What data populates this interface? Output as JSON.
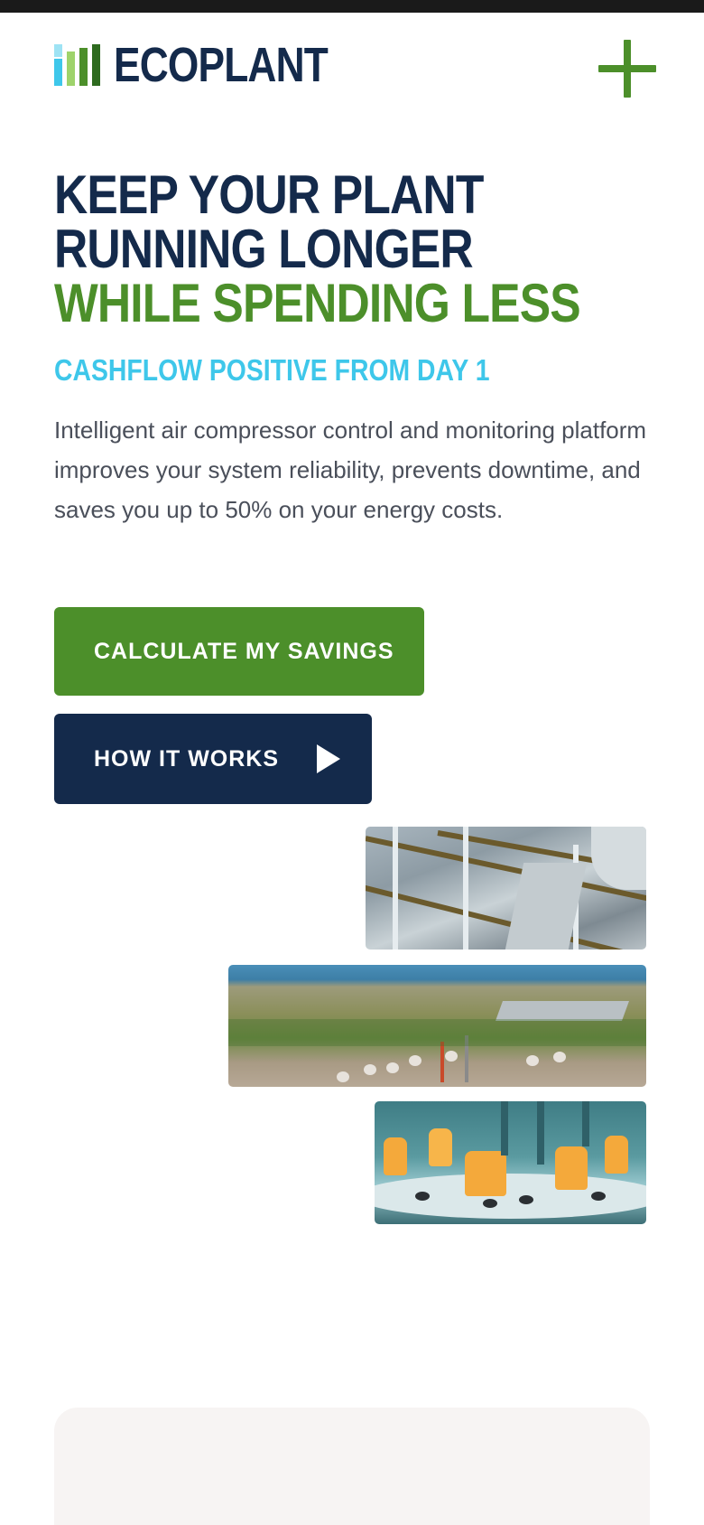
{
  "brand": {
    "name": "ECOPLANT",
    "mark_colors": [
      "#3ec7ea",
      "#9ed36b",
      "#4c8f2a",
      "#2e6b1f"
    ]
  },
  "header": {
    "menu_icon": "plus-icon"
  },
  "hero": {
    "title_line_1": "KEEP YOUR PLANT",
    "title_line_2": "RUNNING LONGER",
    "title_line_3": "WHILE SPENDING LESS",
    "subtitle": "CASHFLOW POSITIVE FROM DAY 1",
    "description": "Intelligent air compressor control and monitoring platform improves your system reliability, prevents downtime, and saves you up to 50% on your energy costs."
  },
  "buttons": {
    "calculate_label": "CALCULATE MY SAVINGS",
    "how_it_works_label": "HOW IT WORKS",
    "how_it_works_icon": "play-icon"
  },
  "colors": {
    "navy": "#142a4b",
    "green": "#4c8f2a",
    "cyan": "#3ec7ea",
    "body_text": "#4a4f5a",
    "card_bg": "#f7f4f3"
  }
}
